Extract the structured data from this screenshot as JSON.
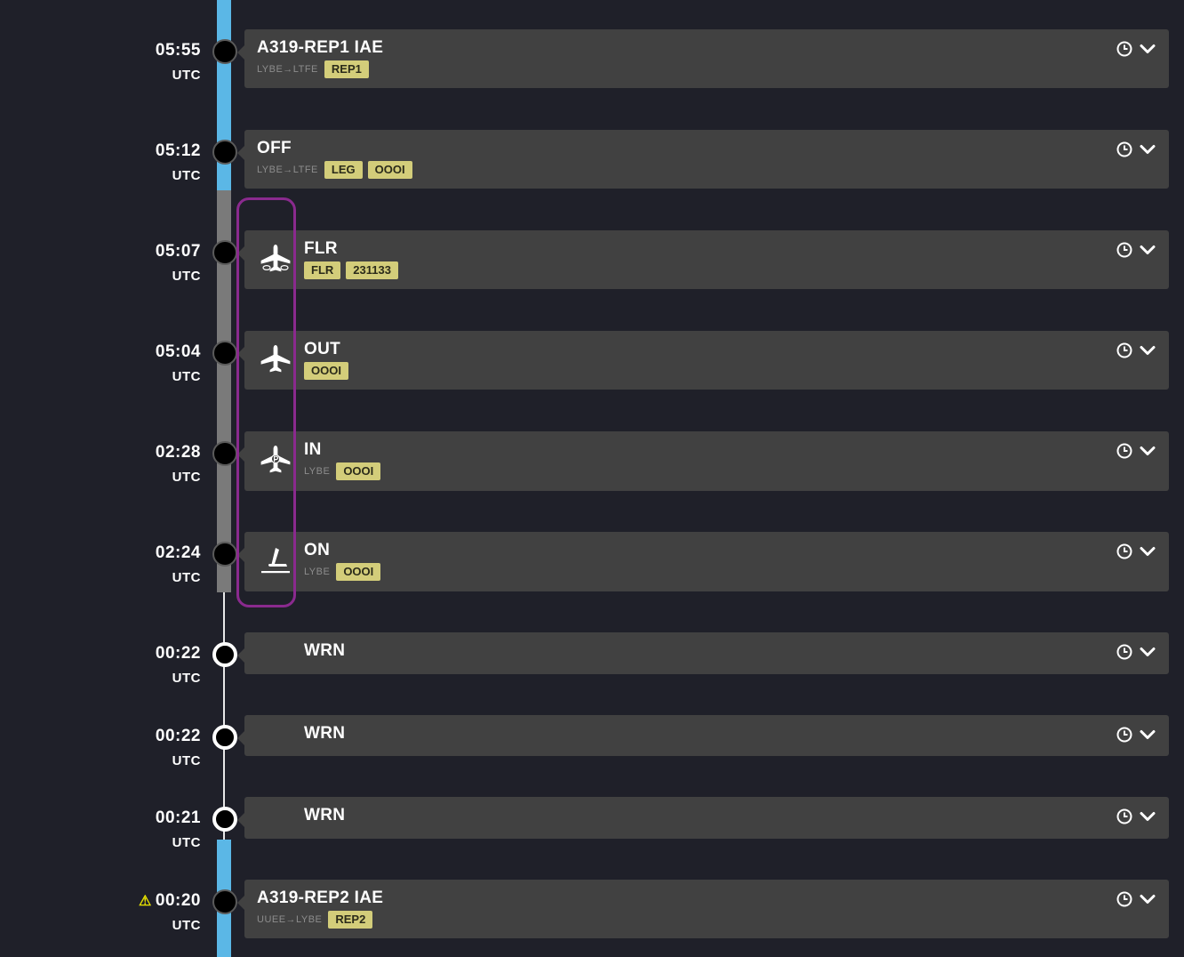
{
  "colors": {
    "background": "#1f2029",
    "card": "#414141",
    "rail_active": "#5bb7e6",
    "rail_inactive": "#7a7a7a",
    "tag": "#d3cd7a",
    "highlight": "#8a2a8e",
    "warning": "#e6e000"
  },
  "events": [
    {
      "time": "05:55",
      "zone": "UTC",
      "title": "A319-REP1 IAE",
      "route": "LYBE→LTFE",
      "tags": [
        "REP1"
      ],
      "icon": "none"
    },
    {
      "time": "05:12",
      "zone": "UTC",
      "title": "OFF",
      "route": "LYBE→LTFE",
      "tags": [
        "LEG",
        "OOOI"
      ],
      "icon": "none"
    },
    {
      "time": "05:07",
      "zone": "UTC",
      "title": "FLR",
      "route": "",
      "tags": [
        "FLR",
        "231133"
      ],
      "icon": "plane-fault-icon"
    },
    {
      "time": "05:04",
      "zone": "UTC",
      "title": "OUT",
      "route": "",
      "tags": [
        "OOOI"
      ],
      "icon": "plane-icon"
    },
    {
      "time": "02:28",
      "zone": "UTC",
      "title": "IN",
      "route": "LYBE",
      "tags": [
        "OOOI"
      ],
      "icon": "plane-parked-icon"
    },
    {
      "time": "02:24",
      "zone": "UTC",
      "title": "ON",
      "route": "LYBE",
      "tags": [
        "OOOI"
      ],
      "icon": "landing-icon"
    },
    {
      "time": "00:22",
      "zone": "UTC",
      "title": "WRN",
      "route": "",
      "tags": [],
      "icon": "none"
    },
    {
      "time": "00:22",
      "zone": "UTC",
      "title": "WRN",
      "route": "",
      "tags": [],
      "icon": "none"
    },
    {
      "time": "00:21",
      "zone": "UTC",
      "title": "WRN",
      "route": "",
      "tags": [],
      "icon": "none"
    },
    {
      "time": "00:20",
      "zone": "UTC",
      "title": "A319-REP2 IAE",
      "route": "UUEE→LYBE",
      "tags": [
        "REP2"
      ],
      "icon": "none",
      "warning": "⚠"
    }
  ]
}
